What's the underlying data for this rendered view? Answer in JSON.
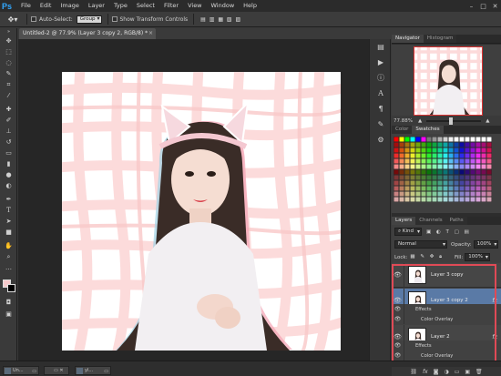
{
  "app": {
    "logo": "Ps"
  },
  "menu": [
    "File",
    "Edit",
    "Image",
    "Layer",
    "Type",
    "Select",
    "Filter",
    "View",
    "Window",
    "Help"
  ],
  "options": {
    "auto_select_label": "Auto-Select:",
    "auto_select_value": "Group",
    "transform_label": "Show Transform Controls"
  },
  "document": {
    "tab_title": "Untitled-2 @ 77.9% (Layer 3 copy 2, RGB/8) *"
  },
  "minimized_docs": [
    {
      "label": "Un..."
    },
    {
      "label": "yl..."
    }
  ],
  "navigator": {
    "tabs": [
      "Navigator",
      "Histogram"
    ],
    "zoom": "77.88%"
  },
  "swatches": {
    "tabs": [
      "Color",
      "Swatches"
    ]
  },
  "layers": {
    "tabs": [
      "Layers",
      "Channels",
      "Paths"
    ],
    "filter_kind": "Kind",
    "blend_mode": "Normal",
    "opacity_label": "Opacity:",
    "opacity_value": "100%",
    "lock_label": "Lock:",
    "fill_label": "Fill:",
    "fill_value": "100%",
    "items": [
      {
        "name": "Layer 3 copy"
      },
      {
        "name": "Layer 3 copy 2",
        "fx": "fx",
        "effects_label": "Effects",
        "effect": "Color Overlay"
      },
      {
        "name": "Layer 2",
        "fx": "fx",
        "effects_label": "Effects",
        "effect": "Color Overlay"
      }
    ]
  },
  "colors": {
    "foreground": "#f5c9cb",
    "background": "#000000",
    "accent_highlight": "#e04a56",
    "selected_layer": "#5a7aa6"
  }
}
